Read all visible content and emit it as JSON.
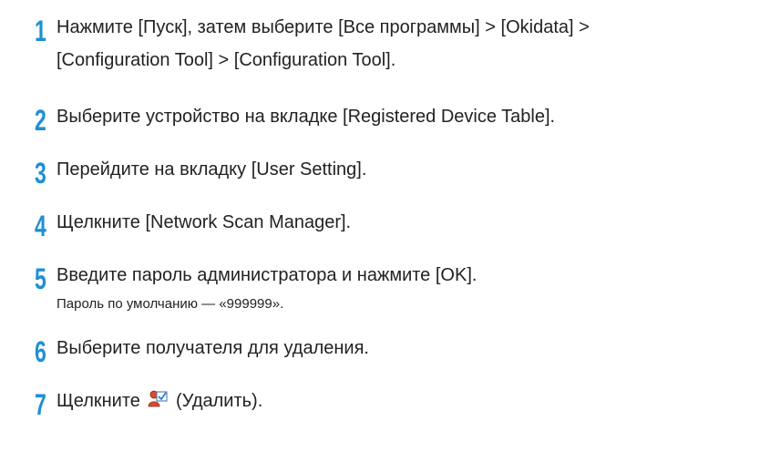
{
  "steps": [
    {
      "number": "1",
      "line1": "Нажмите [Пуск], затем выберите [Все программы] > [Okidata] >",
      "line2": "[Configuration Tool] > [Configuration Tool]."
    },
    {
      "number": "2",
      "text": "Выберите устройство на вкладке [Registered Device Table]."
    },
    {
      "number": "3",
      "text": "Перейдите на вкладку [User Setting]."
    },
    {
      "number": "4",
      "text": "Щелкните [Network Scan Manager]."
    },
    {
      "number": "5",
      "text": "Введите пароль администратора и нажмите [OK].",
      "note": "Пароль по умолчанию — «999999»."
    },
    {
      "number": "6",
      "text": "Выберите получателя для удаления."
    },
    {
      "number": "7",
      "text_before": "Щелкните",
      "icon": "delete-destination-icon",
      "text_after": "(Удалить)."
    }
  ],
  "colors": {
    "step_number": "#1e8fd6",
    "text": "#222222"
  }
}
